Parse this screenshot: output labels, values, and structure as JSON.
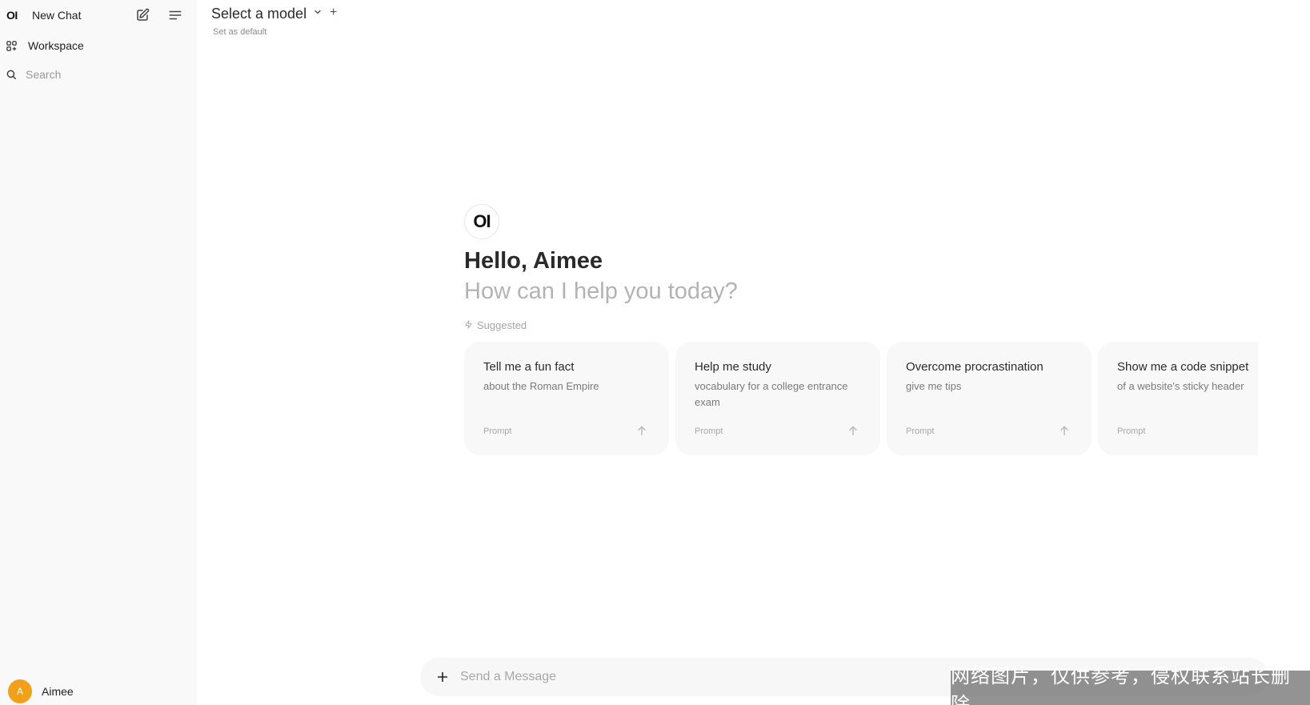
{
  "sidebar": {
    "logo": "OI",
    "new_chat": "New Chat",
    "workspace": "Workspace",
    "search_placeholder": "Search",
    "user": {
      "initial": "A",
      "name": "Aimee"
    }
  },
  "header": {
    "model_select": "Select a model",
    "set_default": "Set as default",
    "add": "+"
  },
  "welcome": {
    "logo": "OI",
    "greeting": "Hello, Aimee",
    "subtitle": "How can I help you today?",
    "suggested_label": "Suggested"
  },
  "suggestions": [
    {
      "title": "Tell me a fun fact",
      "subtitle": "about the Roman Empire",
      "footer": "Prompt"
    },
    {
      "title": "Help me study",
      "subtitle": "vocabulary for a college entrance exam",
      "footer": "Prompt"
    },
    {
      "title": "Overcome procrastination",
      "subtitle": "give me tips",
      "footer": "Prompt"
    },
    {
      "title": "Show me a code snippet",
      "subtitle": "of a website's sticky header",
      "footer": "Prompt"
    }
  ],
  "composer": {
    "placeholder": "Send a Message"
  },
  "watermark": "网络图片，仅供参考，侵权联系站长删除",
  "colors": {
    "sidebar_bg": "#f9f9f9",
    "card_bg": "#f8f8f8",
    "avatar": "#f0a01a",
    "muted_text": "#b3b3b3"
  }
}
